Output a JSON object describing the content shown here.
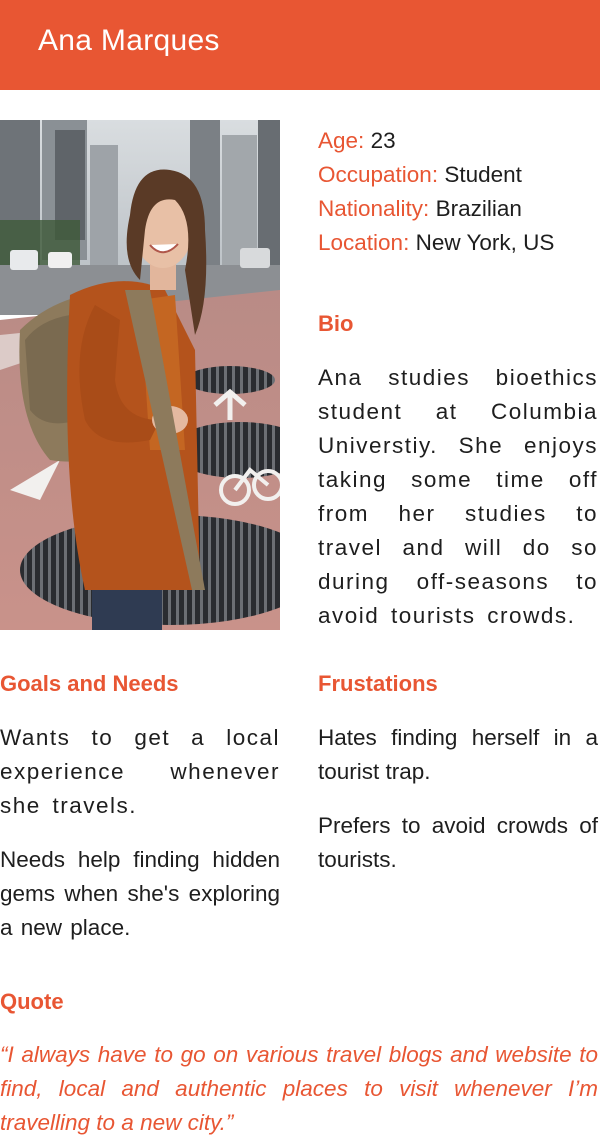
{
  "persona": {
    "name": "Ana Marques"
  },
  "photo": {
    "alt": "Ana Marques portrait"
  },
  "facts": [
    {
      "label": "Age:",
      "value": "23"
    },
    {
      "label": "Occupation:",
      "value": "Student"
    },
    {
      "label": "Nationality:",
      "value": "Brazilian"
    },
    {
      "label": "Location:",
      "value": "New York, US"
    }
  ],
  "bio": {
    "heading": "Bio",
    "text": "Ana studies bioethics student at Columbia Universtiy. She enjoys taking some time off from her studies to travel and will do so during off-seasons to avoid tourists crowds."
  },
  "goals": {
    "heading": "Goals and Needs",
    "items": [
      "Wants to get a local experience whenever she travels.",
      "Needs help finding hid­den gems when she's exploring a new place."
    ]
  },
  "frustrations": {
    "heading": "Frustations",
    "items": [
      "Hates finding herself in a tourist trap.",
      "Prefers to avoid crowds of tourists."
    ]
  },
  "quote": {
    "heading": "Quote",
    "text": "“I always have to go on various travel blogs and website to find, local and authentic places to visit whenever I’m travelling to a new city.”"
  },
  "colors": {
    "accent": "#e85633",
    "text": "#1e1e1e",
    "background": "#ffffff"
  }
}
